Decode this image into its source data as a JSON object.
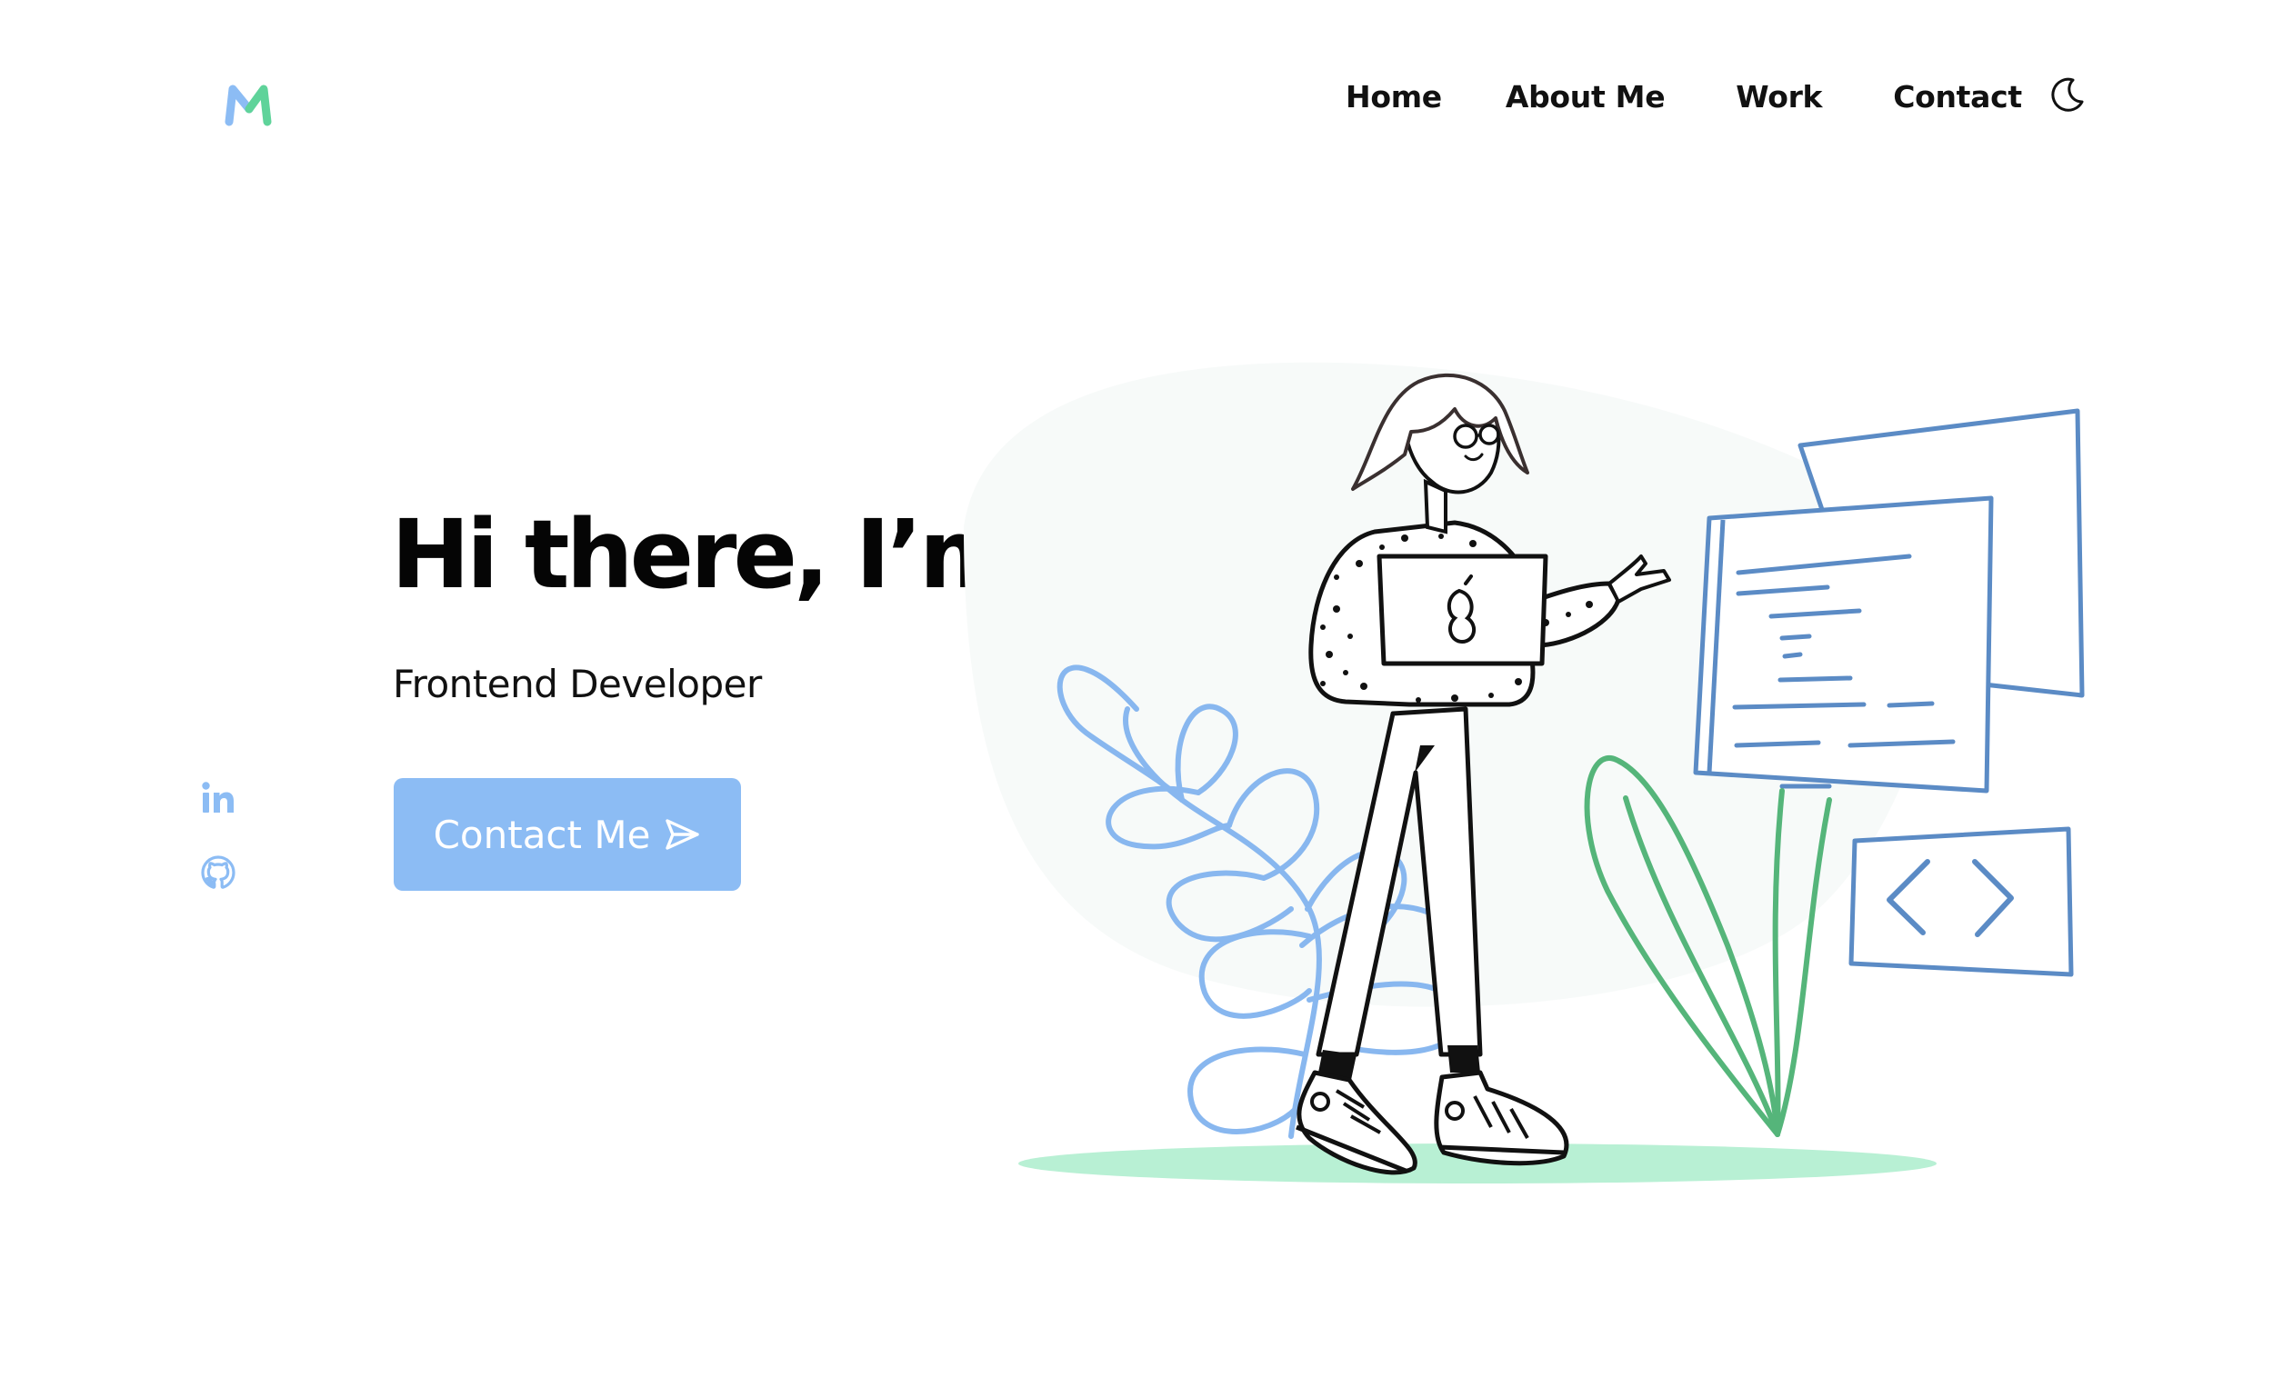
{
  "header": {
    "logo_icon": "m-logo-icon",
    "nav": [
      {
        "label": "Home"
      },
      {
        "label": "About Me"
      },
      {
        "label": "Work"
      },
      {
        "label": "Contact"
      }
    ],
    "theme_toggle_icon": "moon-icon"
  },
  "hero": {
    "title": "Hi there, I’m Minji",
    "subtitle": "Frontend Developer",
    "cta_label": "Contact Me",
    "cta_icon": "send-icon"
  },
  "social": [
    {
      "icon": "linkedin-icon"
    },
    {
      "icon": "github-icon"
    }
  ],
  "colors": {
    "accent": "#8cbcf4",
    "logo_blue": "#8cbcf4",
    "logo_green": "#5fd39a",
    "ink": "#111111",
    "screen_blue": "#5b8bc5",
    "plant_blue": "#88b7ef",
    "plant_green": "#55b57a",
    "ground": "#b8f0d4"
  }
}
